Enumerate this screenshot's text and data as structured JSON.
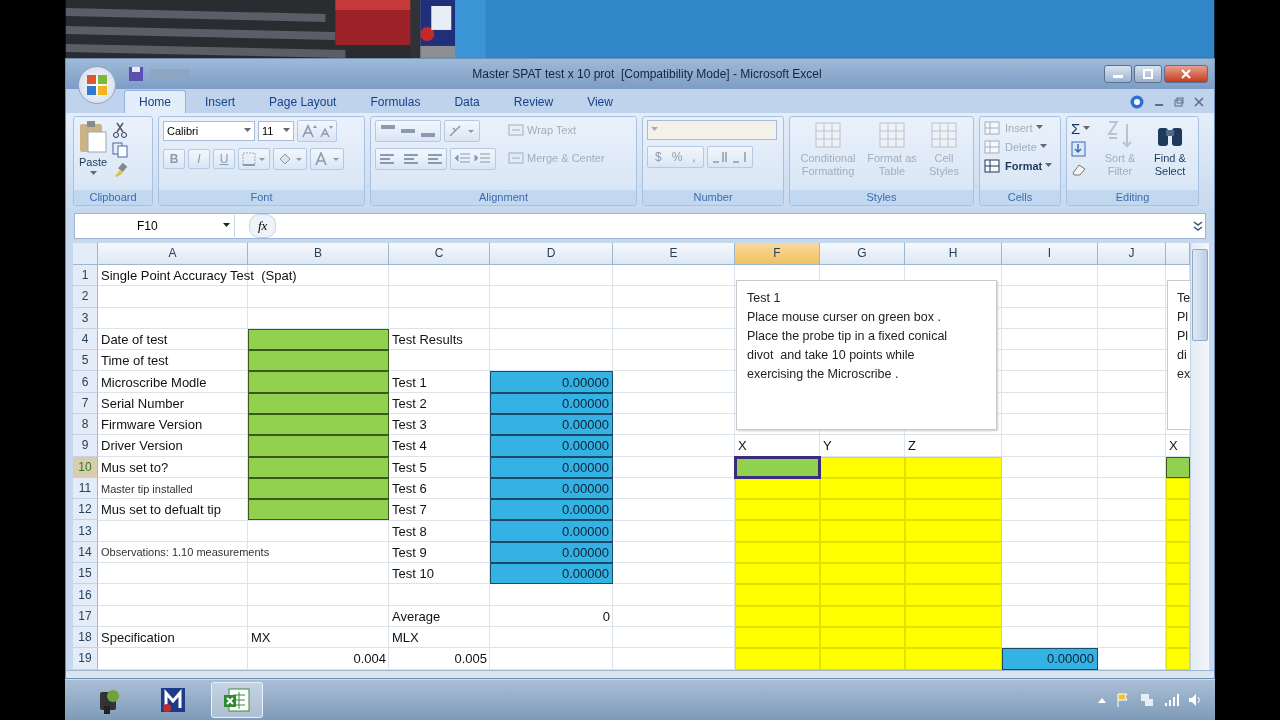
{
  "window": {
    "title": "Master SPAT test x 10 prot  [Compatibility Mode] - Microsoft Excel"
  },
  "ribbon": {
    "tabs": [
      {
        "label": "Home",
        "selected": true
      },
      {
        "label": "Insert",
        "selected": false
      },
      {
        "label": "Page Layout",
        "selected": false
      },
      {
        "label": "Formulas",
        "selected": false
      },
      {
        "label": "Data",
        "selected": false
      },
      {
        "label": "Review",
        "selected": false
      },
      {
        "label": "View",
        "selected": false
      }
    ],
    "groups": [
      {
        "kind": "clipboard",
        "label": "Clipboard",
        "paste": "Paste"
      },
      {
        "kind": "font",
        "label": "Font",
        "font_name": "Calibri",
        "font_size": "11",
        "styles": [
          "B",
          "I",
          "U"
        ]
      },
      {
        "kind": "alignment",
        "label": "Alignment",
        "buttons": [
          {
            "label": "Wrap Text",
            "disabled": true
          },
          {
            "label": "Merge & Center",
            "disabled": true
          }
        ]
      },
      {
        "kind": "number",
        "label": "Number",
        "symbols": [
          "$",
          "%",
          ","
        ]
      },
      {
        "kind": "styles",
        "label": "Styles",
        "buttons": [
          {
            "label": "Conditional Formatting",
            "disabled": true
          },
          {
            "label": "Format as Table",
            "disabled": true
          },
          {
            "label": "Cell Styles",
            "disabled": true
          }
        ]
      },
      {
        "kind": "cells",
        "label": "Cells",
        "buttons": [
          {
            "label": "Insert",
            "disabled": true
          },
          {
            "label": "Delete",
            "disabled": true
          },
          {
            "label": "Format",
            "disabled": false
          }
        ]
      },
      {
        "kind": "editing",
        "label": "Editing",
        "sum": "Σ",
        "buttons": [
          {
            "label": "Sort & Filter",
            "disabled": true
          },
          {
            "label": "Find & Select",
            "disabled": false
          }
        ]
      }
    ]
  },
  "formula_bar": {
    "name_box": "F10",
    "function_label": "fx"
  },
  "sheet": {
    "columns": [
      {
        "letter": "A",
        "selected": false
      },
      {
        "letter": "B",
        "selected": false
      },
      {
        "letter": "C",
        "selected": false
      },
      {
        "letter": "D",
        "selected": false
      },
      {
        "letter": "E",
        "selected": false
      },
      {
        "letter": "F",
        "selected": true
      },
      {
        "letter": "G",
        "selected": false
      },
      {
        "letter": "H",
        "selected": false
      },
      {
        "letter": "I",
        "selected": false
      },
      {
        "letter": "J",
        "selected": false
      },
      {
        "selected": false
      }
    ],
    "rows": [
      {
        "number": "1",
        "selected": false,
        "cells": [
          {
            "text": "Single Point Accuracy Test  (Spat)",
            "kind": "text"
          }
        ]
      },
      {
        "number": "2",
        "selected": false
      },
      {
        "number": "3",
        "selected": false
      },
      {
        "number": "4",
        "selected": false,
        "cells": [
          {
            "text": "Date of test",
            "kind": "text"
          },
          {
            "kind": "input"
          },
          {
            "text": "Test Results",
            "kind": "text"
          }
        ]
      },
      {
        "number": "5",
        "selected": false,
        "cells": [
          {
            "text": "Time of test",
            "kind": "text"
          },
          {
            "kind": "input"
          }
        ]
      },
      {
        "number": "6",
        "selected": false,
        "cells": [
          {
            "text": "Microscribe Modle",
            "kind": "text"
          },
          {
            "kind": "input"
          },
          {
            "text": "Test 1",
            "kind": "text"
          },
          {
            "text": "0.00000",
            "kind": "result"
          }
        ]
      },
      {
        "number": "7",
        "selected": false,
        "cells": [
          {
            "text": "Serial Number",
            "kind": "text"
          },
          {
            "kind": "input"
          },
          {
            "text": "Test 2",
            "kind": "text"
          },
          {
            "text": "0.00000",
            "kind": "result"
          }
        ]
      },
      {
        "number": "8",
        "selected": false,
        "cells": [
          {
            "text": "Firmware Version",
            "kind": "text"
          },
          {
            "kind": "input"
          },
          {
            "text": "Test 3",
            "kind": "text"
          },
          {
            "text": "0.00000",
            "kind": "result"
          }
        ]
      },
      {
        "number": "9",
        "selected": false,
        "cells": [
          {
            "text": "Driver Version",
            "kind": "text"
          },
          {
            "kind": "input"
          },
          {
            "text": "Test 4",
            "kind": "text"
          },
          {
            "text": "0.00000",
            "kind": "result"
          },
          null,
          {
            "text": "X",
            "kind": "text"
          },
          {
            "text": "Y",
            "kind": "text"
          },
          {
            "text": "Z",
            "kind": "text"
          },
          null,
          null,
          {
            "text": "X",
            "kind": "text"
          }
        ]
      },
      {
        "number": "10",
        "selected": true,
        "cells": [
          {
            "text": "Mus set to?",
            "kind": "text"
          },
          {
            "kind": "input"
          },
          {
            "text": "Test 5",
            "kind": "text"
          },
          {
            "text": "0.00000",
            "kind": "result"
          },
          null,
          {
            "kind": "input"
          },
          {
            "kind": "capture"
          },
          {
            "kind": "capture"
          },
          null,
          null,
          {
            "kind": "input"
          }
        ]
      },
      {
        "number": "11",
        "selected": false,
        "cells": [
          {
            "text": "Master tip installed",
            "kind": "note"
          },
          {
            "kind": "input"
          },
          {
            "text": "Test 6",
            "kind": "text"
          },
          {
            "text": "0.00000",
            "kind": "result"
          },
          null,
          {
            "kind": "capture"
          },
          {
            "kind": "capture"
          },
          {
            "kind": "capture"
          },
          null,
          null,
          {
            "kind": "capture"
          }
        ]
      },
      {
        "number": "12",
        "selected": false,
        "cells": [
          {
            "text": "Mus set to defualt tip",
            "kind": "text"
          },
          {
            "kind": "input"
          },
          {
            "text": "Test 7",
            "kind": "text"
          },
          {
            "text": "0.00000",
            "kind": "result"
          },
          null,
          {
            "kind": "capture"
          },
          {
            "kind": "capture"
          },
          {
            "kind": "capture"
          },
          null,
          null,
          {
            "kind": "capture"
          }
        ]
      },
      {
        "number": "13",
        "selected": false,
        "cells": [
          null,
          null,
          {
            "text": "Test 8",
            "kind": "text"
          },
          {
            "text": "0.00000",
            "kind": "result"
          },
          null,
          {
            "kind": "capture"
          },
          {
            "kind": "capture"
          },
          {
            "kind": "capture"
          },
          null,
          null,
          {
            "kind": "capture"
          }
        ]
      },
      {
        "number": "14",
        "selected": false,
        "cells": [
          {
            "text": "Observations: 1.10 measurements",
            "kind": "note"
          },
          null,
          {
            "text": "Test 9",
            "kind": "text"
          },
          {
            "text": "0.00000",
            "kind": "result"
          },
          null,
          {
            "kind": "capture"
          },
          {
            "kind": "capture"
          },
          {
            "kind": "capture"
          },
          null,
          null,
          {
            "kind": "capture"
          }
        ]
      },
      {
        "number": "15",
        "selected": false,
        "cells": [
          null,
          null,
          {
            "text": "Test 10",
            "kind": "text"
          },
          {
            "text": "0.00000",
            "kind": "result"
          },
          null,
          {
            "kind": "capture"
          },
          {
            "kind": "capture"
          },
          {
            "kind": "capture"
          },
          null,
          null,
          {
            "kind": "capture"
          }
        ]
      },
      {
        "number": "16",
        "selected": false,
        "cells": [
          null,
          null,
          null,
          null,
          null,
          {
            "kind": "capture"
          },
          {
            "kind": "capture"
          },
          {
            "kind": "capture"
          },
          null,
          null,
          {
            "kind": "capture"
          }
        ]
      },
      {
        "number": "17",
        "selected": false,
        "cells": [
          null,
          null,
          {
            "text": "Average",
            "kind": "text"
          },
          {
            "text": "0",
            "kind": "number"
          },
          null,
          {
            "kind": "capture"
          },
          {
            "kind": "capture"
          },
          {
            "kind": "capture"
          },
          null,
          null,
          {
            "kind": "capture"
          }
        ]
      },
      {
        "number": "18",
        "selected": false,
        "cells": [
          {
            "text": "Specification",
            "kind": "text"
          },
          {
            "text": "MX",
            "kind": "text"
          },
          {
            "text": "MLX",
            "kind": "text"
          },
          null,
          null,
          {
            "kind": "capture"
          },
          {
            "kind": "capture"
          },
          {
            "kind": "capture"
          },
          null,
          null,
          {
            "kind": "capture"
          }
        ]
      },
      {
        "number": "19",
        "selected": false,
        "cells": [
          null,
          {
            "text": "0.004",
            "kind": "number"
          },
          {
            "text": "0.005",
            "kind": "number"
          },
          null,
          null,
          {
            "kind": "capture"
          },
          {
            "kind": "capture"
          },
          {
            "kind": "capture"
          },
          {
            "text": "0.00000",
            "kind": "result"
          },
          null,
          {
            "kind": "capture"
          }
        ]
      }
    ],
    "text_boxes": [
      {
        "lines": [
          "Test 1",
          "Place mouse curser on green box .",
          "Place the probe tip in a fixed conical",
          "divot  and take 10 points while",
          "exercising the Microscribe ."
        ]
      },
      {
        "lines": [
          "Te",
          "Pl",
          "Pl",
          "di",
          "ex"
        ]
      }
    ]
  },
  "taskbar": {
    "apps": [
      {
        "kind": "camera",
        "selected": false
      },
      {
        "kind": "logo",
        "selected": false
      },
      {
        "kind": "excel",
        "selected": true
      }
    ]
  }
}
